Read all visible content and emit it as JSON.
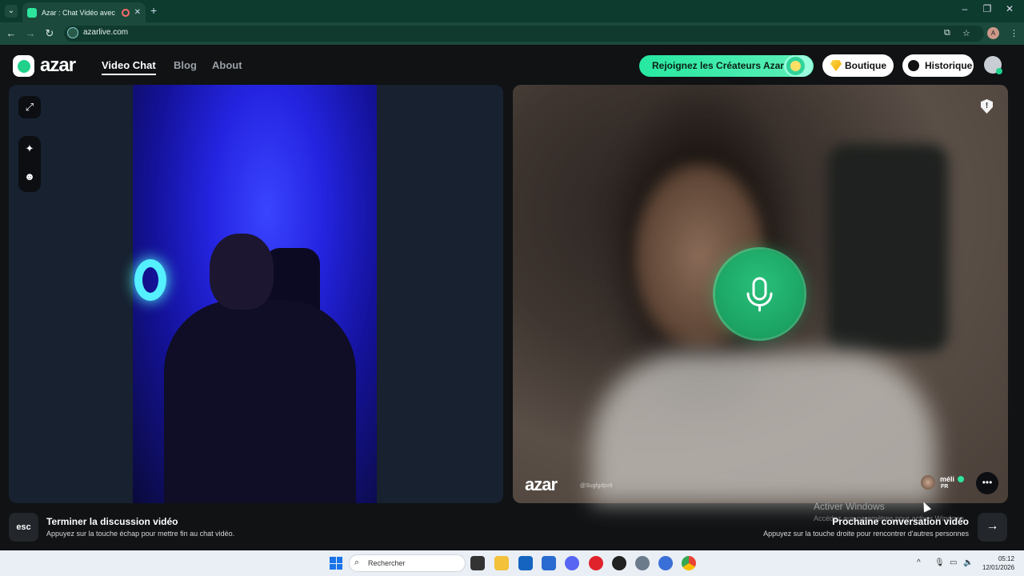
{
  "browser": {
    "tab_title": "Azar : Chat Vidéo avec de n",
    "url": "azarlive.com",
    "profile_initial": "A"
  },
  "site": {
    "logo_text": "azar",
    "nav": [
      {
        "label": "Video Chat",
        "active": true
      },
      {
        "label": "Blog",
        "active": false
      },
      {
        "label": "About",
        "active": false
      }
    ],
    "creators_label": "Rejoignez les Créateurs Azar",
    "shop_label": "Boutique",
    "history_label": "Historique"
  },
  "remote_video": {
    "watermark": "azar",
    "watermark_id": "@Sugfgdpv9",
    "peer_name": "méli",
    "peer_country": "FR"
  },
  "bottom_bar": {
    "esc_key": "esc",
    "end_title": "Terminer la discussion vidéo",
    "end_sub": "Appuyez sur la touche échap pour mettre fin au chat vidéo.",
    "next_title": "Prochaine conversation vidéo",
    "next_sub": "Appuyez sur la touche droite pour rencontrer d'autres personnes"
  },
  "windows_overlay": {
    "title": "Activer Windows",
    "sub": "Accédez aux paramètres pour activer Windows."
  },
  "taskbar": {
    "search_placeholder": "Rechercher",
    "time": "05:12",
    "date": "12/01/2026"
  },
  "colors": {
    "brand_green": "#1fd18b",
    "tab_bar": "#0d3b2e",
    "mic_green": "#1fa866"
  }
}
